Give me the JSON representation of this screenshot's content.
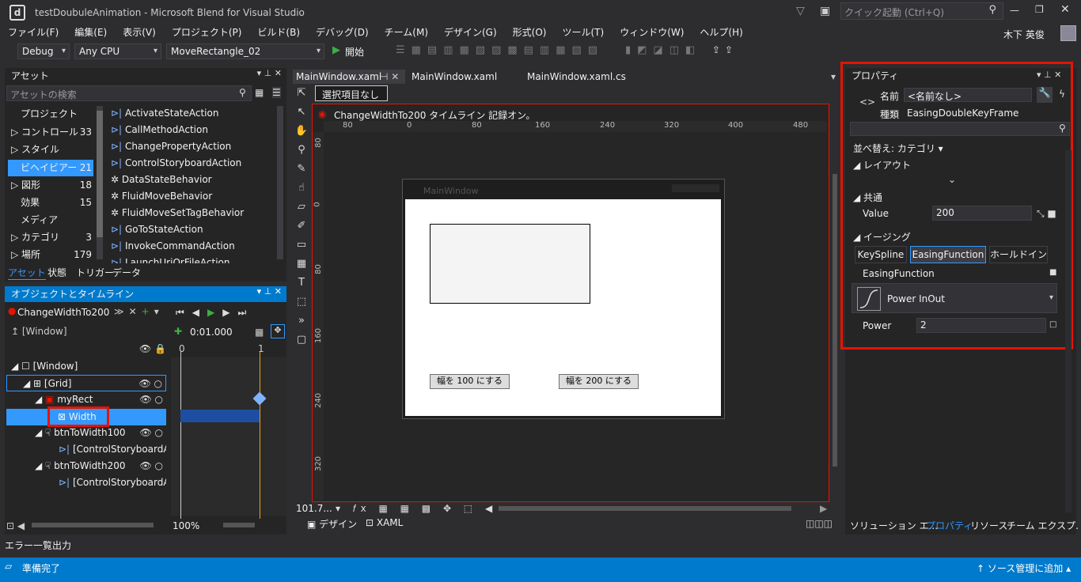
{
  "app": {
    "title": "testDoubuleAnimation - Microsoft Blend for Visual Studio",
    "quick_launch_placeholder": "クイック起動 (Ctrl+Q)",
    "user": "木下 英俊"
  },
  "menu": [
    "ファイル(F)",
    "編集(E)",
    "表示(V)",
    "プロジェクト(P)",
    "ビルド(B)",
    "デバッグ(D)",
    "チーム(M)",
    "デザイン(G)",
    "形式(O)",
    "ツール(T)",
    "ウィンドウ(W)",
    "ヘルプ(H)"
  ],
  "toolbar": {
    "config": "Debug",
    "platform": "Any CPU",
    "project": "MoveRectangle_02",
    "start": "開始"
  },
  "assets": {
    "title": "アセット",
    "search_placeholder": "アセットの検索",
    "categories": [
      {
        "label": "プロジェクト",
        "count": ""
      },
      {
        "label": "コントロール",
        "count": "33"
      },
      {
        "label": "スタイル",
        "count": ""
      },
      {
        "label": "ビヘイビアー",
        "count": "21"
      },
      {
        "label": "図形",
        "count": "18"
      },
      {
        "label": "効果",
        "count": "15"
      },
      {
        "label": "メディア",
        "count": ""
      },
      {
        "label": "カテゴリ",
        "count": "3"
      },
      {
        "label": "場所",
        "count": "179"
      }
    ],
    "items": [
      "ActivateStateAction",
      "CallMethodAction",
      "ChangePropertyAction",
      "ControlStoryboardAction",
      "DataStateBehavior",
      "FluidMoveBehavior",
      "FluidMoveSetTagBehavior",
      "GoToStateAction",
      "InvokeCommandAction",
      "LaunchUriOrFileAction"
    ],
    "tabs": [
      "アセット",
      "状態",
      "トリガー",
      "データ"
    ]
  },
  "objects": {
    "title": "オブジェクトとタイムライン",
    "storyboard": "ChangeWidthTo200",
    "time": "0:01.000",
    "window_root": "[Window]",
    "tree": [
      "[Window]",
      "[Grid]",
      "myRect",
      "Width",
      "btnToWidth100",
      "[ControlStoryboardActi",
      "btnToWidth200",
      "[ControlStoryboardActi"
    ],
    "ticks": [
      "0",
      "1"
    ],
    "zoom": "100%"
  },
  "editor": {
    "tabs": [
      "MainWindow.xaml",
      "MainWindow.xaml",
      "MainWindow.xaml.cs"
    ],
    "selection": "選択項目なし",
    "recording": "ChangeWidthTo200 タイムライン 記録オン。",
    "hruler": [
      "80",
      "0",
      "80",
      "160",
      "240",
      "320",
      "400",
      "480"
    ],
    "vruler": [
      "80",
      "0",
      "80",
      "160",
      "240",
      "320"
    ],
    "window_title": "MainWindow",
    "btn1": "幅を 100 にする",
    "btn2": "幅を 200 にする",
    "zoom": "101.7...",
    "view_tabs": [
      "デザイン",
      "XAML"
    ]
  },
  "properties": {
    "title": "プロパティ",
    "name_label": "名前",
    "name_value": "<名前なし>",
    "type_label": "種類",
    "type_value": "EasingDoubleKeyFrame",
    "sort": "並べ替え: カテゴリ",
    "sections": [
      "レイアウト",
      "共通",
      "イージング"
    ],
    "value_label": "Value",
    "value": "200",
    "easing_tabs": [
      "KeySpline",
      "EasingFunction",
      "ホールドイン"
    ],
    "easing_function_label": "EasingFunction",
    "easing_value": "Power InOut",
    "power_label": "Power",
    "power_value": "2",
    "bottom_tabs": [
      "ソリューション エ...",
      "プロパティ",
      "リソース",
      "チーム エクスプ..."
    ]
  },
  "bottom": {
    "tabs": [
      "エラー一覧",
      "出力"
    ]
  },
  "status": {
    "text": "準備完了",
    "right": "ソース管理に追加"
  }
}
